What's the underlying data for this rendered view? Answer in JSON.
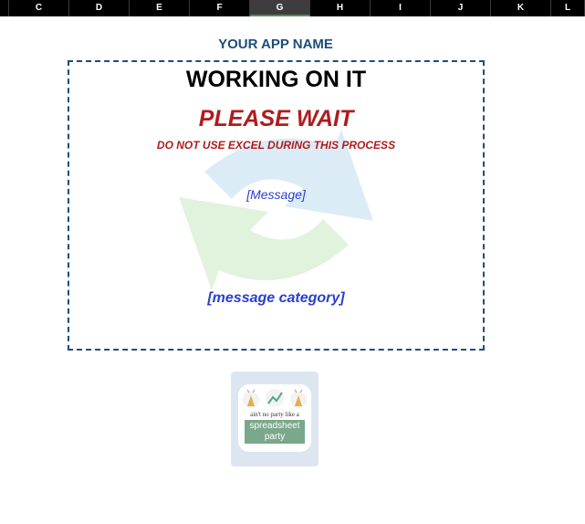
{
  "columns": [
    {
      "label": "C",
      "selected": false
    },
    {
      "label": "D",
      "selected": false
    },
    {
      "label": "E",
      "selected": false
    },
    {
      "label": "F",
      "selected": false
    },
    {
      "label": "G",
      "selected": true
    },
    {
      "label": "H",
      "selected": false
    },
    {
      "label": "I",
      "selected": false
    },
    {
      "label": "J",
      "selected": false
    },
    {
      "label": "K",
      "selected": false
    },
    {
      "label": "L",
      "selected": false
    }
  ],
  "app_name": "YOUR APP NAME",
  "status": {
    "heading": "WORKING ON IT",
    "please_wait": "PLEASE WAIT",
    "warning": "DO NOT USE EXCEL DURING THIS PROCESS",
    "message": "[Message]",
    "message_category": "[message category]",
    "background_icon": "refresh-arrows-icon"
  },
  "logo": {
    "icon": "party-logo-icon",
    "tagline": "ain't no party like a",
    "line1": "spreadsheet",
    "line2": "party"
  },
  "colors": {
    "accent_blue": "#1f4e79",
    "warning_red": "#b01c1c",
    "message_blue": "#2a3fd1",
    "logo_green": "#7aa88a"
  }
}
